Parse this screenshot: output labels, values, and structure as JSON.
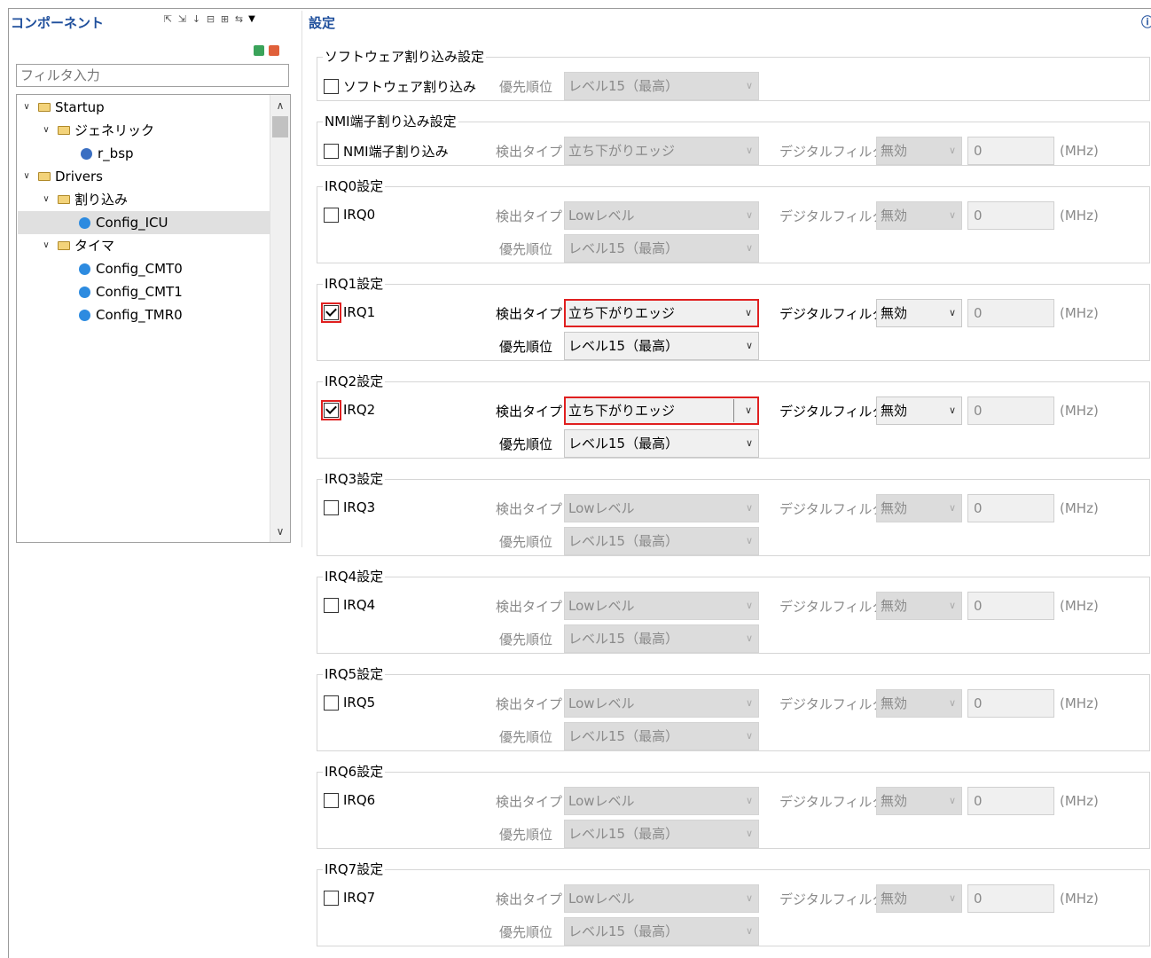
{
  "left_panel": {
    "title": "コンポーネント",
    "filter_placeholder": "フィルタ入力",
    "tree": [
      {
        "label": "Startup",
        "level": 0,
        "type": "folder"
      },
      {
        "label": "ジェネリック",
        "level": 1,
        "type": "folder"
      },
      {
        "label": "r_bsp",
        "level": 2,
        "type": "component"
      },
      {
        "label": "Drivers",
        "level": 0,
        "type": "folder"
      },
      {
        "label": "割り込み",
        "level": 1,
        "type": "folder"
      },
      {
        "label": "Config_ICU",
        "level": 2,
        "type": "component",
        "selected": true
      },
      {
        "label": "タイマ",
        "level": 1,
        "type": "folder"
      },
      {
        "label": "Config_CMT0",
        "level": 2,
        "type": "component"
      },
      {
        "label": "Config_CMT1",
        "level": 2,
        "type": "component"
      },
      {
        "label": "Config_TMR0",
        "level": 2,
        "type": "component"
      }
    ]
  },
  "settings": {
    "title": "設定",
    "software": {
      "group_label": "ソフトウェア割り込み設定",
      "checkbox_label": "ソフトウェア割り込み",
      "priority_label": "優先順位",
      "priority_value": "レベル15（最高）"
    },
    "nmi": {
      "group_label": "NMI端子割り込み設定",
      "checkbox_label": "NMI端子割り込み",
      "detect_label": "検出タイプ",
      "detect_value": "立ち下がりエッジ",
      "filter_label": "デジタルフィルタ",
      "filter_value": "無効",
      "freq_value": "0",
      "unit": "(MHz)"
    },
    "irqs": [
      {
        "group_label": "IRQ0設定",
        "checkbox_label": "IRQ0",
        "checked": false,
        "detect_label": "検出タイプ",
        "detect_value": "Lowレベル",
        "priority_label": "優先順位",
        "priority_value": "レベル15（最高）",
        "filter_label": "デジタルフィルタ",
        "filter_value": "無効",
        "freq_value": "0",
        "unit": "(MHz)"
      },
      {
        "group_label": "IRQ1設定",
        "checkbox_label": "IRQ1",
        "checked": true,
        "detect_label": "検出タイプ",
        "detect_value": "立ち下がりエッジ",
        "priority_label": "優先順位",
        "priority_value": "レベル15（最高）",
        "filter_label": "デジタルフィルタ",
        "filter_value": "無効",
        "freq_value": "0",
        "unit": "(MHz)"
      },
      {
        "group_label": "IRQ2設定",
        "checkbox_label": "IRQ2",
        "checked": true,
        "detect_label": "検出タイプ",
        "detect_value": "立ち下がりエッジ",
        "priority_label": "優先順位",
        "priority_value": "レベル15（最高）",
        "filter_label": "デジタルフィルタ",
        "filter_value": "無効",
        "freq_value": "0",
        "unit": "(MHz)"
      },
      {
        "group_label": "IRQ3設定",
        "checkbox_label": "IRQ3",
        "checked": false,
        "detect_label": "検出タイプ",
        "detect_value": "Lowレベル",
        "priority_label": "優先順位",
        "priority_value": "レベル15（最高）",
        "filter_label": "デジタルフィルタ",
        "filter_value": "無効",
        "freq_value": "0",
        "unit": "(MHz)"
      },
      {
        "group_label": "IRQ4設定",
        "checkbox_label": "IRQ4",
        "checked": false,
        "detect_label": "検出タイプ",
        "detect_value": "Lowレベル",
        "priority_label": "優先順位",
        "priority_value": "レベル15（最高）",
        "filter_label": "デジタルフィルタ",
        "filter_value": "無効",
        "freq_value": "0",
        "unit": "(MHz)"
      },
      {
        "group_label": "IRQ5設定",
        "checkbox_label": "IRQ5",
        "checked": false,
        "detect_label": "検出タイプ",
        "detect_value": "Lowレベル",
        "priority_label": "優先順位",
        "priority_value": "レベル15（最高）",
        "filter_label": "デジタルフィルタ",
        "filter_value": "無効",
        "freq_value": "0",
        "unit": "(MHz)"
      },
      {
        "group_label": "IRQ6設定",
        "checkbox_label": "IRQ6",
        "checked": false,
        "detect_label": "検出タイプ",
        "detect_value": "Lowレベル",
        "priority_label": "優先順位",
        "priority_value": "レベル15（最高）",
        "filter_label": "デジタルフィルタ",
        "filter_value": "無効",
        "freq_value": "0",
        "unit": "(MHz)"
      },
      {
        "group_label": "IRQ7設定",
        "checkbox_label": "IRQ7",
        "checked": false,
        "detect_label": "検出タイプ",
        "detect_value": "Lowレベル",
        "priority_label": "優先順位",
        "priority_value": "レベル15（最高）",
        "filter_label": "デジタルフィルタ",
        "filter_value": "無効",
        "freq_value": "0",
        "unit": "(MHz)"
      }
    ]
  },
  "colors": {
    "accent": "#1f4f9c",
    "highlight": "#e02020",
    "selection": "#e0e0e0"
  }
}
